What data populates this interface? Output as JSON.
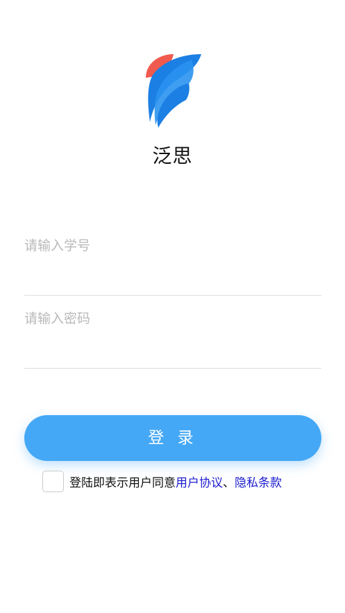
{
  "app": {
    "name": "泛思"
  },
  "form": {
    "student_id_placeholder": "请输入学号",
    "password_placeholder": "请输入密码",
    "login_label": "登 录"
  },
  "agreement": {
    "prefix": "登陆即表示用户同意",
    "user_agreement": "用户协议",
    "separator": "、",
    "privacy_policy": "隐私条款"
  },
  "colors": {
    "primary": "#45a8f6",
    "logo_blue": "#1c7fe3",
    "logo_red": "#f05a4e",
    "link": "#1c1cd0"
  },
  "icons": {
    "logo": "f-shaped-leaf-logo-icon"
  }
}
